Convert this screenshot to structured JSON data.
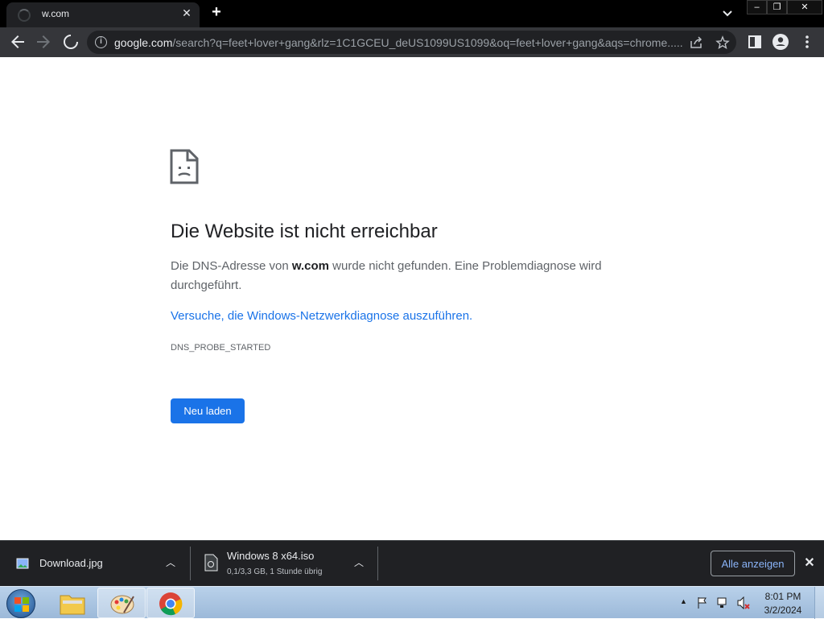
{
  "browser": {
    "tab": {
      "title": "w.com",
      "close_icon": "close-icon",
      "loading_icon": "spinner-icon"
    },
    "new_tab_icon": "plus-icon",
    "window_controls": {
      "minimize": "–",
      "restore": "❐",
      "close": "✕"
    },
    "toolbar": {
      "back_icon": "arrow-left-icon",
      "forward_icon": "arrow-right-icon",
      "stop_icon": "stop-loading-icon",
      "url_host": "google.com",
      "url_path": "/search?q=feet+lover+gang&rlz=1C1GCEU_deUS1099US1099&oq=feet+lover+gang&aqs=chrome....."
    }
  },
  "error_page": {
    "title": "Die Website ist nicht erreichbar",
    "desc_prefix": "Die DNS-Adresse von ",
    "desc_domain": "w.com",
    "desc_suffix": " wurde nicht gefunden. Eine Problemdiagnose wird durchgeführt.",
    "link_text": "Versuche, die Windows-Netzwerkdiagnose auszuführen.",
    "error_code": "DNS_PROBE_STARTED",
    "reload_label": "Neu laden"
  },
  "downloads": {
    "items": [
      {
        "name": "Download.jpg",
        "status": ""
      },
      {
        "name": "Windows 8 x64.iso",
        "status": "0,1/3,3 GB, 1 Stunde übrig"
      }
    ],
    "show_all_label": "Alle anzeigen"
  },
  "taskbar": {
    "time": "8:01 PM",
    "date": "3/2/2024",
    "apps": [
      "windows-explorer",
      "paint",
      "chrome"
    ]
  },
  "colors": {
    "accent": "#1a73e8",
    "link": "#1a73e8",
    "shelf_bg": "#202124",
    "toolbar_bg": "#35363a"
  }
}
